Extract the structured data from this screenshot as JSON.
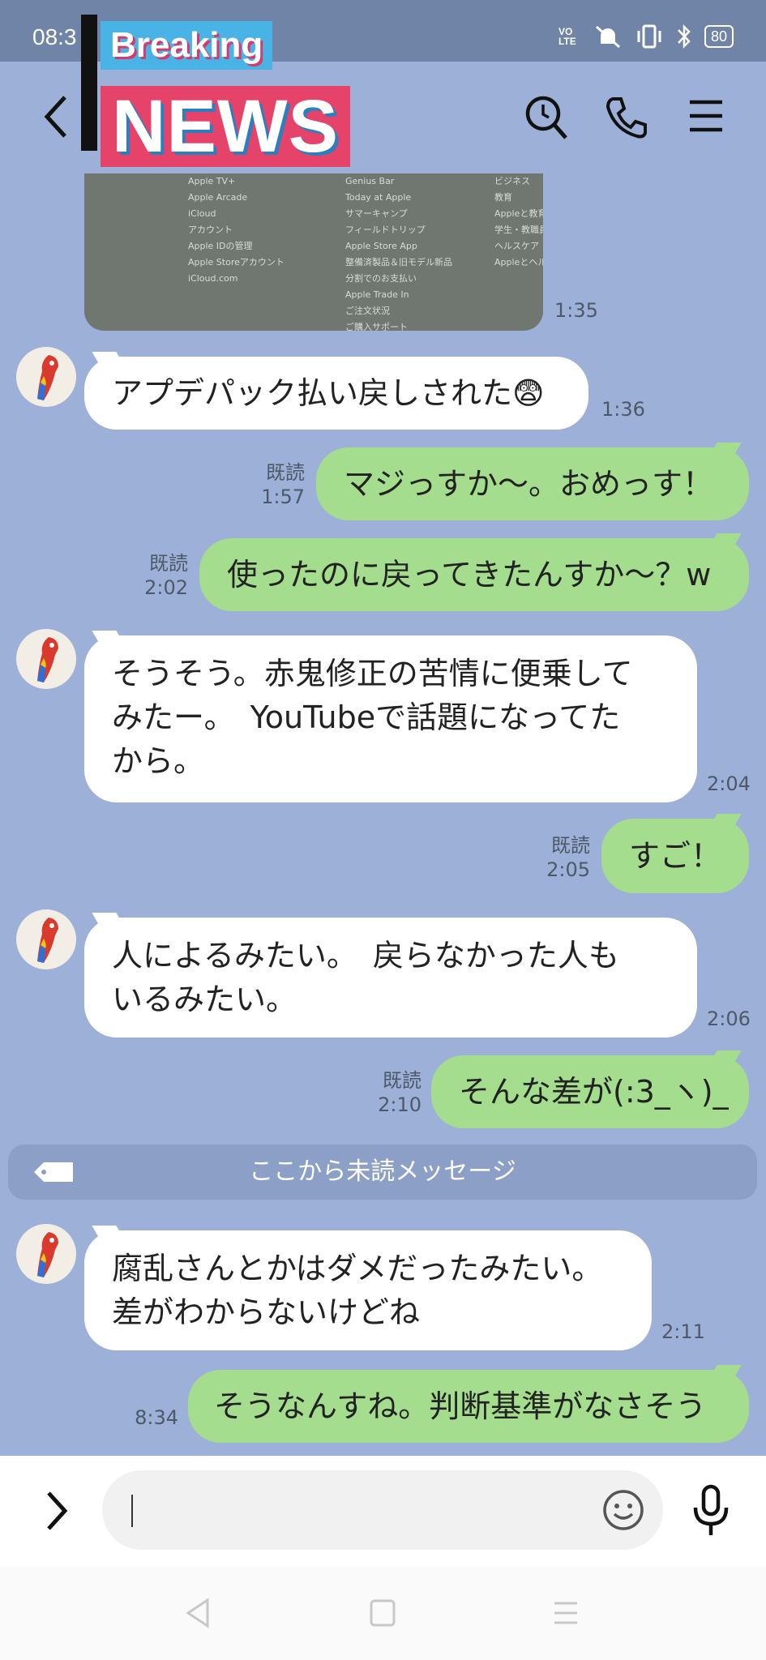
{
  "status_bar": {
    "time": "08:3",
    "network": "VO LTE",
    "battery": "80"
  },
  "header": {
    "overlay_breaking": "Breaking",
    "overlay_news": "NEWS",
    "icons": [
      "back-icon",
      "search-icon",
      "phone-icon",
      "menu-icon"
    ]
  },
  "photo": {
    "col1": [
      "Apple TV+",
      "Apple Arcade",
      "iCloud",
      "",
      "アカウント",
      "Apple IDの管理",
      "Apple Storeアカウント",
      "iCloud.com"
    ],
    "col2": [
      "Genius Bar",
      "Today at Apple",
      "サマーキャンプ",
      "フィールドトリップ",
      "Apple Store App",
      "整備済製品＆旧モデル新品",
      "分割でのお支払い",
      "Apple Trade In",
      "ご注文状況",
      "ご購入サポート"
    ],
    "col3": [
      "ビジネス",
      "",
      "教育",
      "Appleと教育",
      "学生・教職員",
      "",
      "ヘルスケア",
      "Appleとヘルス"
    ],
    "time": "1:35"
  },
  "messages": [
    {
      "id": "m1",
      "text": "アプデパック払い戻しされた😨",
      "time": "1:36"
    },
    {
      "id": "m2",
      "text": "マジっすか〜。おめっす！",
      "read": "既読",
      "time": "1:57"
    },
    {
      "id": "m3",
      "text": "使ったのに戻ってきたんすか〜？w",
      "read": "既読",
      "time": "2:02"
    },
    {
      "id": "m4",
      "lines": [
        "そうそう。赤鬼修正の苦情に便乗して",
        "みたー。　YouTubeで話題になってた",
        "から。"
      ],
      "time": "2:04"
    },
    {
      "id": "m5",
      "text": "すご！",
      "read": "既読",
      "time": "2:05"
    },
    {
      "id": "m6",
      "lines": [
        "人によるみたい。　戻らなかった人も",
        "いるみたい。"
      ],
      "time": "2:06"
    },
    {
      "id": "m7",
      "text": "そんな差が(:3_ヽ)_",
      "read": "既読",
      "time": "2:10"
    },
    {
      "id": "m8",
      "lines": [
        "腐乱さんとかはダメだったみたい。",
        "差がわからないけどね"
      ],
      "time": "2:11"
    },
    {
      "id": "m9",
      "text": "そうなんすね。判断基準がなさそう",
      "time": "8:34"
    }
  ],
  "unread_divider": "ここから未読メッセージ",
  "input_bar": {
    "placeholder": ""
  },
  "colors": {
    "background": "#9db0d8",
    "outgoing_bubble": "#a3dd8d",
    "incoming_bubble": "#ffffff"
  }
}
